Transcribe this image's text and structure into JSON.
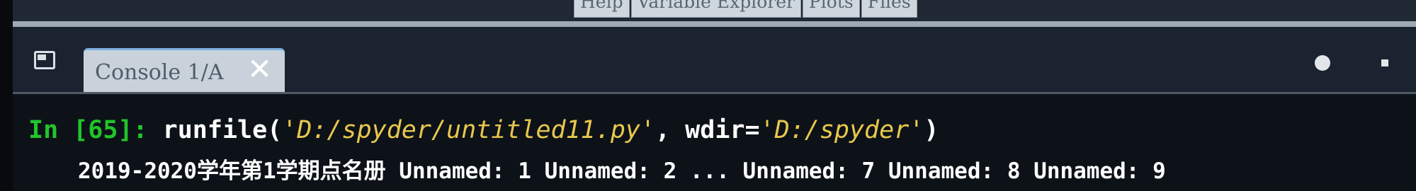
{
  "top_tabs": [
    "Help",
    "Variable Explorer",
    "Plots",
    "Files"
  ],
  "pane": {
    "tab_label": "Console 1/A",
    "close_icon": "close-icon",
    "undock_icon": "undock-icon",
    "options_icon": "options-icon",
    "menu_icon": "menu-icon"
  },
  "console": {
    "prompt": "In [65]:",
    "command_fn": "runfile(",
    "command_arg1": "'D:/spyder/untitled11.py'",
    "command_sep": ", wdir=",
    "command_arg2": "'D:/spyder'",
    "command_end": ")",
    "output_line": "2019-2020学年第1学期点名册 Unnamed: 1 Unnamed: 2  ... Unnamed: 7 Unnamed: 8 Unnamed: 9"
  },
  "colors": {
    "prompt_green": "#21c52a",
    "string_yellow": "#e8c74d",
    "background": "#0d1219"
  }
}
